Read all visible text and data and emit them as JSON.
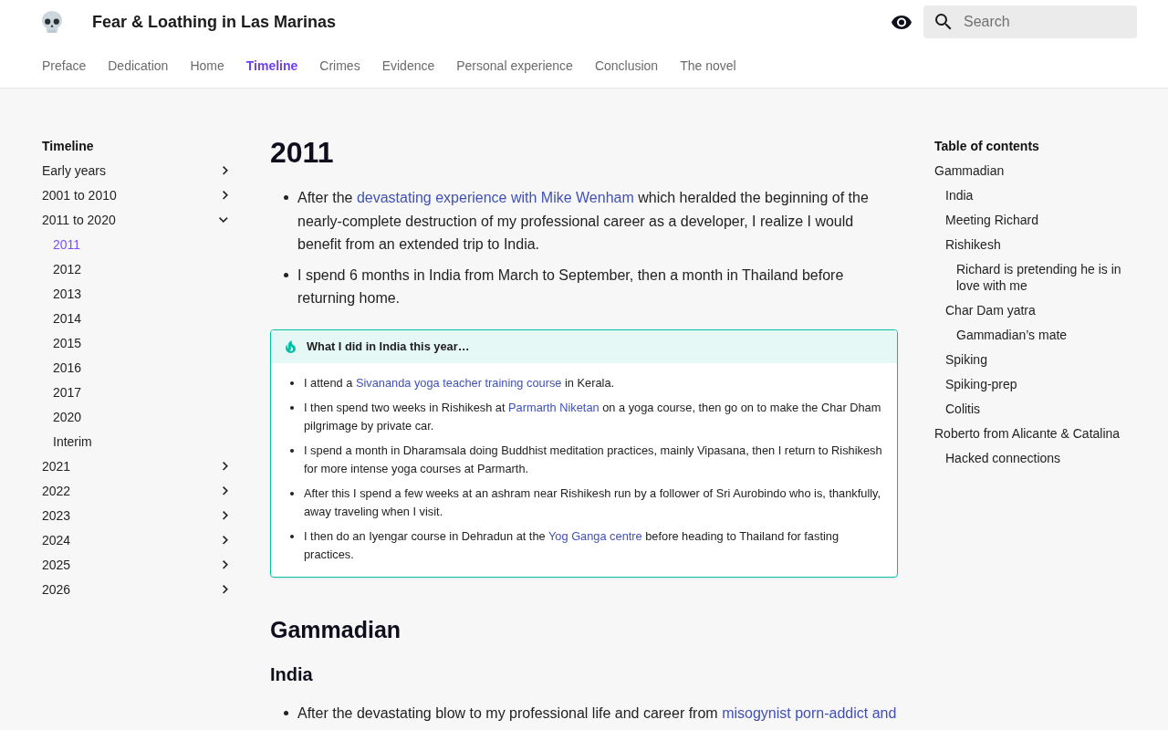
{
  "header": {
    "title": "Fear & Loathing in Las Marinas",
    "search": {
      "placeholder": "Search"
    }
  },
  "tabs": [
    {
      "label": "Preface",
      "selected": false
    },
    {
      "label": "Dedication",
      "selected": false
    },
    {
      "label": "Home",
      "selected": false
    },
    {
      "label": "Timeline",
      "selected": true
    },
    {
      "label": "Crimes",
      "selected": false
    },
    {
      "label": "Evidence",
      "selected": false
    },
    {
      "label": "Personal experience",
      "selected": false
    },
    {
      "label": "Conclusion",
      "selected": false
    },
    {
      "label": "The novel",
      "selected": false
    }
  ],
  "nav": {
    "title": "Timeline",
    "items": [
      {
        "label": "Early years",
        "selected": false,
        "expanded": false
      },
      {
        "label": "2001 to 2010",
        "selected": false,
        "expanded": false
      },
      {
        "label": "2011 to 2020",
        "selected": false,
        "expanded": true,
        "children": [
          {
            "label": "2011",
            "selected": true
          },
          {
            "label": "2012",
            "selected": false
          },
          {
            "label": "2013",
            "selected": false
          },
          {
            "label": "2014",
            "selected": false
          },
          {
            "label": "2015",
            "selected": false
          },
          {
            "label": "2016",
            "selected": false
          },
          {
            "label": "2017",
            "selected": false
          },
          {
            "label": "2020",
            "selected": false
          },
          {
            "label": "Interim",
            "selected": false
          }
        ]
      },
      {
        "label": "2021",
        "selected": false,
        "expanded": false
      },
      {
        "label": "2022",
        "selected": false,
        "expanded": false
      },
      {
        "label": "2023",
        "selected": false,
        "expanded": false
      },
      {
        "label": "2024",
        "selected": false,
        "expanded": false
      },
      {
        "label": "2025",
        "selected": false,
        "expanded": false
      },
      {
        "label": "2026",
        "selected": false,
        "expanded": false
      }
    ]
  },
  "article": {
    "title": "2011",
    "bullets": [
      {
        "parts": [
          {
            "kind": "text",
            "text": "After the "
          },
          {
            "kind": "link",
            "text": "devastating experience with Mike Wenham"
          },
          {
            "kind": "text",
            "text": " which heralded the beginning of the nearly-complete destruction of my professional career as a developer, I realize I would benefit from an extended trip to India."
          }
        ]
      },
      {
        "parts": [
          {
            "kind": "text",
            "text": "I spend 6 months in India from March to September, then a month in Thailand before returning home."
          }
        ]
      }
    ],
    "callout": {
      "title": "What I did in India this year…",
      "bullets": [
        {
          "parts": [
            {
              "kind": "text",
              "text": "I attend a "
            },
            {
              "kind": "link",
              "text": "Sivananda yoga teacher training course"
            },
            {
              "kind": "text",
              "text": " in Kerala."
            }
          ]
        },
        {
          "parts": [
            {
              "kind": "text",
              "text": "I then spend two weeks in Rishikesh at "
            },
            {
              "kind": "link",
              "text": "Parmarth Niketan"
            },
            {
              "kind": "text",
              "text": " on a yoga course, then go on to make the Char Dham pilgrimage by private car."
            }
          ]
        },
        {
          "parts": [
            {
              "kind": "text",
              "text": "I spend a month in Dharamsala doing Buddhist meditation practices, mainly Vipasana, then I return to Rishikesh for more intense yoga courses at Parmarth."
            }
          ]
        },
        {
          "parts": [
            {
              "kind": "text",
              "text": "After this I spend a few weeks at an ashram near Rishikesh run by a follower of Sri Aurobindo who is, thankfully, away traveling when I visit."
            }
          ]
        },
        {
          "parts": [
            {
              "kind": "text",
              "text": "I then do an Iyengar course in Dehradun at the "
            },
            {
              "kind": "link",
              "text": "Yog Ganga centre"
            },
            {
              "kind": "text",
              "text": " before heading to Thailand for fasting practices."
            }
          ]
        }
      ]
    },
    "sections": [
      {
        "kind": "h2",
        "text": "Gammadian"
      },
      {
        "kind": "h3",
        "text": "India"
      },
      {
        "kind": "list",
        "bullets": [
          {
            "parts": [
              {
                "kind": "text",
                "text": "After the devastating blow to my professional life and career from "
              },
              {
                "kind": "link",
                "text": "misogynist porn-addict and"
              }
            ]
          }
        ]
      }
    ]
  },
  "toc": {
    "title": "Table of contents",
    "items": [
      {
        "label": "Gammadian",
        "children": [
          {
            "label": "India"
          },
          {
            "label": "Meeting Richard"
          },
          {
            "label": "Rishikesh",
            "children": [
              {
                "label": "Richard is pretending he is in love with me"
              }
            ]
          },
          {
            "label": "Char Dam yatra",
            "children": [
              {
                "label": "Gammadian’s mate"
              }
            ]
          },
          {
            "label": "Spiking"
          },
          {
            "label": "Spiking-prep"
          },
          {
            "label": "Colitis"
          }
        ]
      },
      {
        "label": "Roberto from Alicante & Catalina",
        "children": [
          {
            "label": "Hacked connections"
          }
        ]
      }
    ]
  }
}
